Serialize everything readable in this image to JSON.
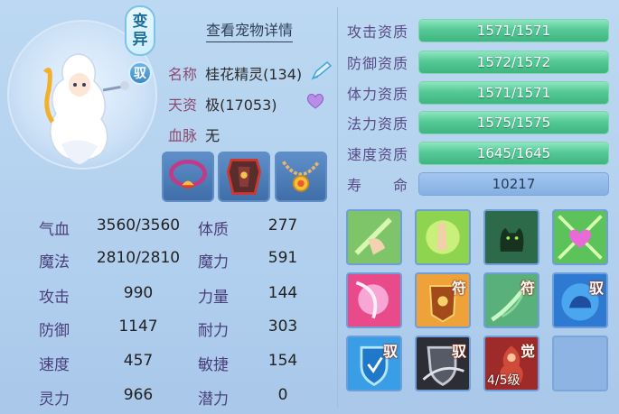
{
  "pet": {
    "badge_top": "变",
    "badge_bottom": "异",
    "badge_circle": "驭",
    "detail_link": "查看宠物详情",
    "name_label": "名称",
    "name_value": "桂花精灵(134)",
    "talent_label": "天资",
    "talent_value": "极(17053)",
    "blood_label": "血脉",
    "blood_value": "无"
  },
  "equipment": [
    {
      "name": "collar-equip-icon"
    },
    {
      "name": "armor-equip-icon"
    },
    {
      "name": "necklace-equip-icon"
    }
  ],
  "stats": [
    {
      "label": "气血",
      "value": "3560/3560",
      "label2": "体质",
      "value2": "277"
    },
    {
      "label": "魔法",
      "value": "2810/2810",
      "label2": "魔力",
      "value2": "591"
    },
    {
      "label": "攻击",
      "value": "990",
      "label2": "力量",
      "value2": "144"
    },
    {
      "label": "防御",
      "value": "1147",
      "label2": "耐力",
      "value2": "303"
    },
    {
      "label": "速度",
      "value": "457",
      "label2": "敏捷",
      "value2": "154"
    },
    {
      "label": "灵力",
      "value": "966",
      "label2": "潜力",
      "value2": "0"
    }
  ],
  "attributes": [
    {
      "label": "攻击资质",
      "value": "1571/1571"
    },
    {
      "label": "防御资质",
      "value": "1572/1572"
    },
    {
      "label": "体力资质",
      "value": "1571/1571"
    },
    {
      "label": "法力资质",
      "value": "1575/1575"
    },
    {
      "label": "速度资质",
      "value": "1645/1645"
    },
    {
      "label": "寿　　命",
      "value": "10217"
    }
  ],
  "skills": [
    {
      "name": "hand-gesture-skill",
      "tag": "",
      "level": ""
    },
    {
      "name": "palm-skill",
      "tag": "",
      "level": ""
    },
    {
      "name": "cat-skill",
      "tag": "",
      "level": ""
    },
    {
      "name": "heart-skill",
      "tag": "",
      "level": ""
    },
    {
      "name": "pink-swirl-skill",
      "tag": "",
      "level": ""
    },
    {
      "name": "shield-talisman-skill",
      "tag": "符",
      "level": ""
    },
    {
      "name": "green-arrow-skill",
      "tag": "符",
      "level": ""
    },
    {
      "name": "blue-beast-skill",
      "tag": "驭",
      "level": ""
    },
    {
      "name": "shield-skill",
      "tag": "驭",
      "level": ""
    },
    {
      "name": "gray-shield-skill",
      "tag": "驭",
      "level": ""
    },
    {
      "name": "awaken-skill",
      "tag": "觉",
      "level": "4/5级"
    },
    {
      "name": "empty-slot",
      "tag": "",
      "level": ""
    }
  ]
}
